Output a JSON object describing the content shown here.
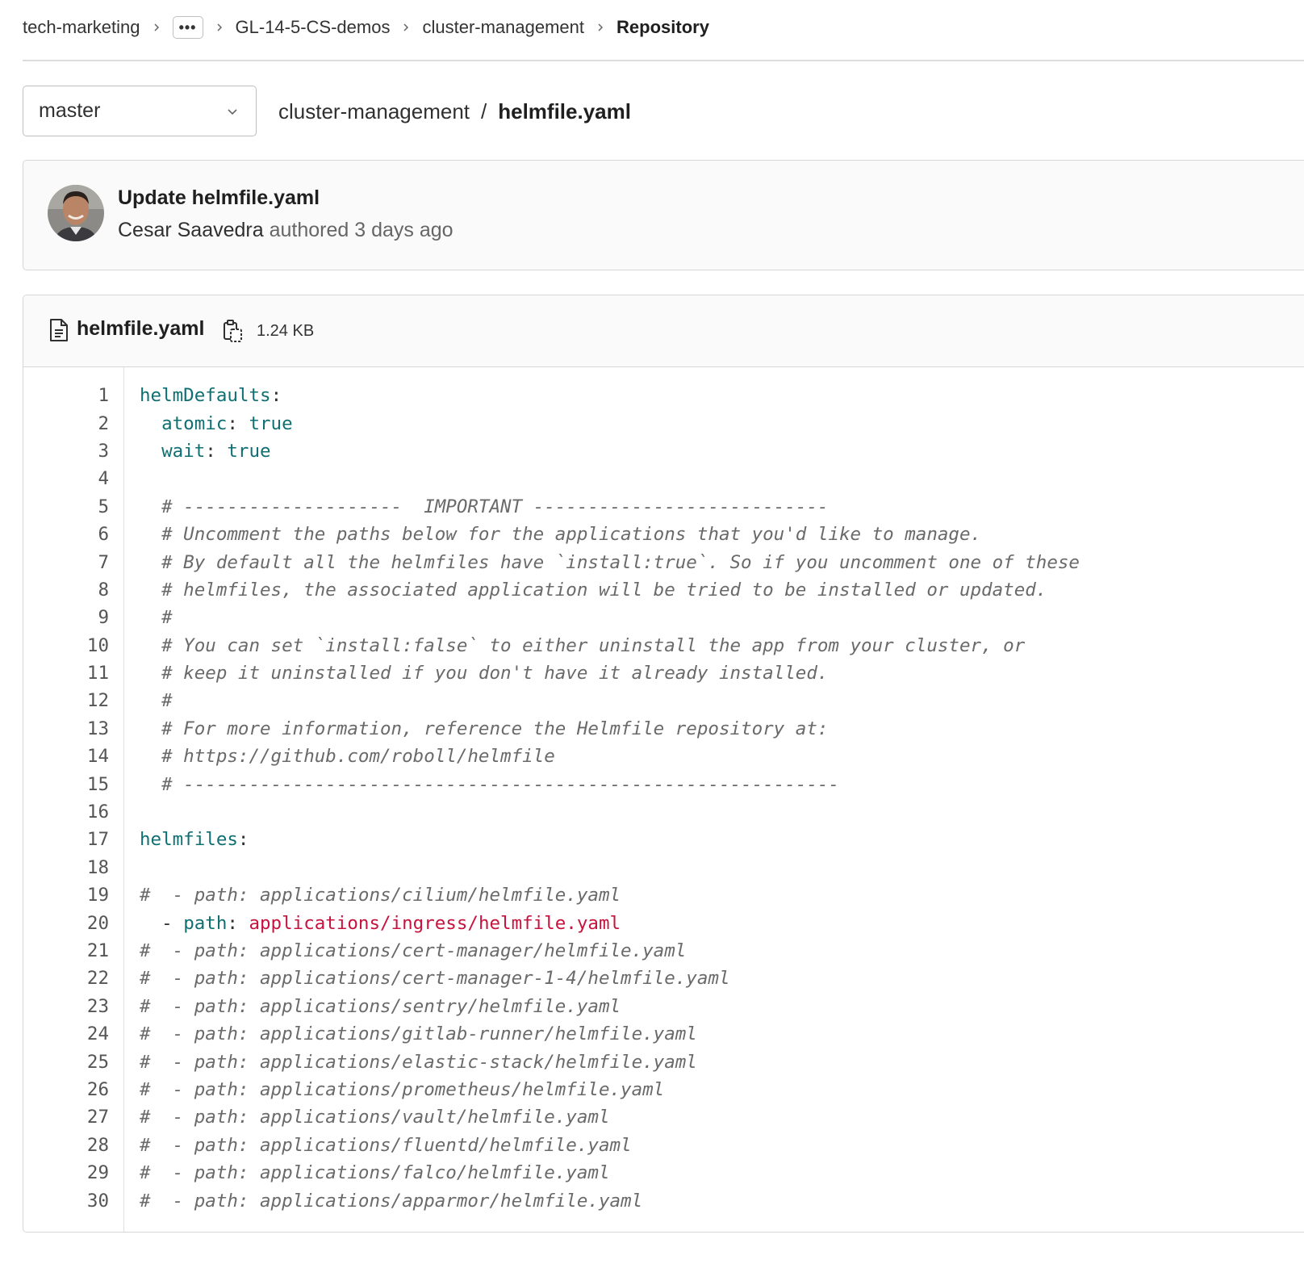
{
  "breadcrumb": {
    "items": [
      "tech-marketing",
      "GL-14-5-CS-demos",
      "cluster-management",
      "Repository"
    ],
    "ellipsis": "•••"
  },
  "branch": {
    "selected": "master"
  },
  "path": {
    "repo": "cluster-management",
    "separator": "/",
    "file": "helmfile.yaml"
  },
  "commit": {
    "title": "Update helmfile.yaml",
    "author": "Cesar Saavedra",
    "meta": "authored 3 days ago"
  },
  "file": {
    "name": "helmfile.yaml",
    "size": "1.24 KB"
  },
  "code": {
    "line_numbers": [
      "1",
      "2",
      "3",
      "4",
      "5",
      "6",
      "7",
      "8",
      "9",
      "10",
      "11",
      "12",
      "13",
      "14",
      "15",
      "16",
      "17",
      "18",
      "19",
      "20",
      "21",
      "22",
      "23",
      "24",
      "25",
      "26",
      "27",
      "28",
      "29",
      "30"
    ],
    "lines": [
      [
        {
          "t": "k",
          "v": "helmDefaults"
        },
        {
          "t": "p",
          "v": ":"
        }
      ],
      [
        {
          "t": "p",
          "v": "  "
        },
        {
          "t": "k",
          "v": "atomic"
        },
        {
          "t": "p",
          "v": ": "
        },
        {
          "t": "v",
          "v": "true"
        }
      ],
      [
        {
          "t": "p",
          "v": "  "
        },
        {
          "t": "k",
          "v": "wait"
        },
        {
          "t": "p",
          "v": ": "
        },
        {
          "t": "v",
          "v": "true"
        }
      ],
      [],
      [
        {
          "t": "c",
          "v": "  # --------------------  IMPORTANT ---------------------------"
        }
      ],
      [
        {
          "t": "c",
          "v": "  # Uncomment the paths below for the applications that you'd like to manage."
        }
      ],
      [
        {
          "t": "c",
          "v": "  # By default all the helmfiles have `install:true`. So if you uncomment one of these"
        }
      ],
      [
        {
          "t": "c",
          "v": "  # helmfiles, the associated application will be tried to be installed or updated."
        }
      ],
      [
        {
          "t": "c",
          "v": "  #"
        }
      ],
      [
        {
          "t": "c",
          "v": "  # You can set `install:false` to either uninstall the app from your cluster, or"
        }
      ],
      [
        {
          "t": "c",
          "v": "  # keep it uninstalled if you don't have it already installed."
        }
      ],
      [
        {
          "t": "c",
          "v": "  #"
        }
      ],
      [
        {
          "t": "c",
          "v": "  # For more information, reference the Helmfile repository at:"
        }
      ],
      [
        {
          "t": "c",
          "v": "  # https://github.com/roboll/helmfile"
        }
      ],
      [
        {
          "t": "c",
          "v": "  # ------------------------------------------------------------"
        }
      ],
      [],
      [
        {
          "t": "k",
          "v": "helmfiles"
        },
        {
          "t": "p",
          "v": ":"
        }
      ],
      [],
      [
        {
          "t": "c",
          "v": "#  - path: applications/cilium/helmfile.yaml"
        }
      ],
      [
        {
          "t": "p",
          "v": "  - "
        },
        {
          "t": "k",
          "v": "path"
        },
        {
          "t": "p",
          "v": ": "
        },
        {
          "t": "s",
          "v": "applications/ingress/helmfile.yaml"
        }
      ],
      [
        {
          "t": "c",
          "v": "#  - path: applications/cert-manager/helmfile.yaml"
        }
      ],
      [
        {
          "t": "c",
          "v": "#  - path: applications/cert-manager-1-4/helmfile.yaml"
        }
      ],
      [
        {
          "t": "c",
          "v": "#  - path: applications/sentry/helmfile.yaml"
        }
      ],
      [
        {
          "t": "c",
          "v": "#  - path: applications/gitlab-runner/helmfile.yaml"
        }
      ],
      [
        {
          "t": "c",
          "v": "#  - path: applications/elastic-stack/helmfile.yaml"
        }
      ],
      [
        {
          "t": "c",
          "v": "#  - path: applications/prometheus/helmfile.yaml"
        }
      ],
      [
        {
          "t": "c",
          "v": "#  - path: applications/vault/helmfile.yaml"
        }
      ],
      [
        {
          "t": "c",
          "v": "#  - path: applications/fluentd/helmfile.yaml"
        }
      ],
      [
        {
          "t": "c",
          "v": "#  - path: applications/falco/helmfile.yaml"
        }
      ],
      [
        {
          "t": "c",
          "v": "#  - path: applications/apparmor/helmfile.yaml"
        }
      ]
    ]
  },
  "icons": {
    "breadcrumb_separator": "chevron-right-icon",
    "branch_dropdown": "chevron-down-icon",
    "file": "file-icon",
    "copy": "copy-icon"
  },
  "colors": {
    "key": "#0f6f72",
    "string": "#c7133d",
    "comment": "#6a6a6a"
  }
}
